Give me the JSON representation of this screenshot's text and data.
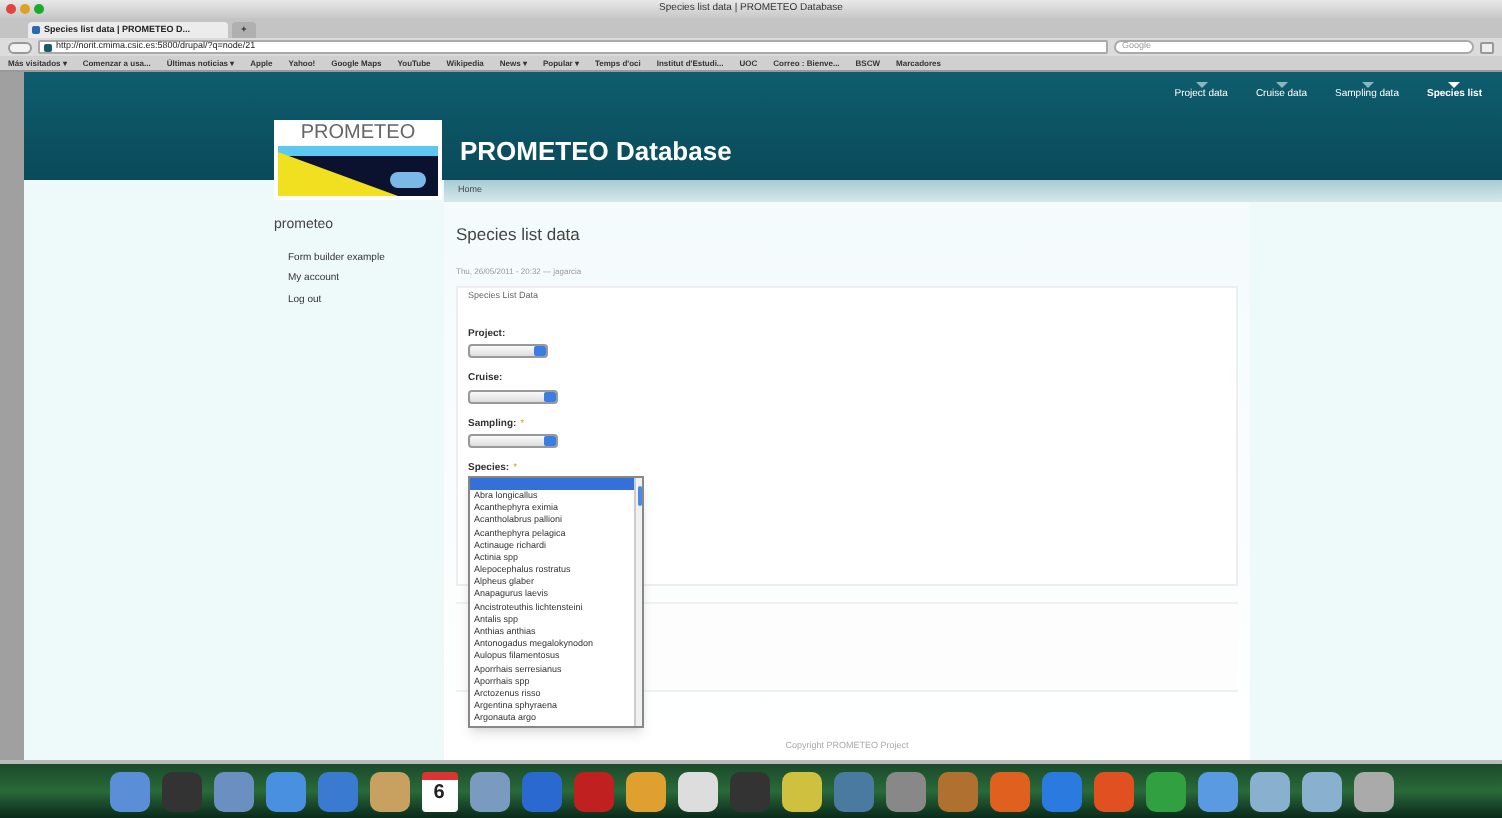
{
  "window": {
    "title": "Species list data | PROMETEO Database"
  },
  "tabs": [
    {
      "label": "Species list data | PROMETEO D...",
      "selected": true
    },
    {
      "label": "+",
      "selected": false
    }
  ],
  "address_bar": {
    "url": "http://norit.cmima.csic.es:5800/drupal/?q=node/21",
    "search_placeholder": "Google"
  },
  "bookmarks": [
    "Más visitados ▾",
    "Comenzar a usa...",
    "Últimas noticias ▾",
    "Apple",
    "Yahoo!",
    "Google Maps",
    "YouTube",
    "Wikipedia",
    "News ▾",
    "Popular ▾",
    "Temps d'oci",
    "Institut d'Estudi...",
    "UOC",
    "Correo : Bienve...",
    "BSCW",
    "Marcadores"
  ],
  "site": {
    "logo_text": "PROMETEO",
    "title": "PROMETEO Database",
    "nav": [
      {
        "label": "Project data",
        "selected": false
      },
      {
        "label": "Cruise data",
        "selected": false
      },
      {
        "label": "Sampling data",
        "selected": false
      },
      {
        "label": "Species list",
        "selected": true
      }
    ],
    "breadcrumb": "Home"
  },
  "sidebar": {
    "title": "prometeo",
    "items": [
      "Form builder example",
      "My account",
      "Log out"
    ]
  },
  "content": {
    "title": "Species list data",
    "meta": "Thu, 26/05/2011 - 20:32 — jagarcia",
    "fieldset": "Species List Data",
    "fields": [
      {
        "label": "Project:"
      },
      {
        "label": "Cruise:"
      },
      {
        "label": "Sampling:",
        "required_mark": "*"
      },
      {
        "label": "Species:",
        "required_mark": "*"
      }
    ],
    "species_options": [
      {
        "selected": true
      },
      {
        "label": "Abra longicallus",
        "selected": false
      },
      {
        "label": "Acanthephyra eximia",
        "selected": false
      },
      {
        "label": "Acantholabrus pallioni",
        "selected": false
      },
      {
        "label": "Acanthephyra pelagica",
        "selected": false
      },
      {
        "label": "Actinauge richardi",
        "selected": false
      },
      {
        "label": "Actinia spp",
        "selected": false
      },
      {
        "label": "Alepocephalus rostratus",
        "selected": false
      },
      {
        "label": "Alpheus glaber",
        "selected": false
      },
      {
        "label": "Anapagurus laevis",
        "selected": false
      },
      {
        "label": "Ancistroteuthis lichtensteini",
        "selected": false
      },
      {
        "label": "Antalis spp",
        "selected": false
      },
      {
        "label": "Anthias anthias",
        "selected": false
      },
      {
        "label": "Antonogadus megalokynodon",
        "selected": false
      },
      {
        "label": "Aulopus filamentosus",
        "selected": false
      },
      {
        "label": "Aporrhais serresianus",
        "selected": false
      },
      {
        "label": "Aporrhais spp",
        "selected": false
      },
      {
        "label": "Arctozenus risso",
        "selected": false
      },
      {
        "label": "Argentina sphyraena",
        "selected": false
      },
      {
        "label": "Argonauta argo",
        "selected": false
      }
    ]
  },
  "footer": "Copyright PROMETEO Project",
  "dock": {
    "calendar_day": "6"
  }
}
